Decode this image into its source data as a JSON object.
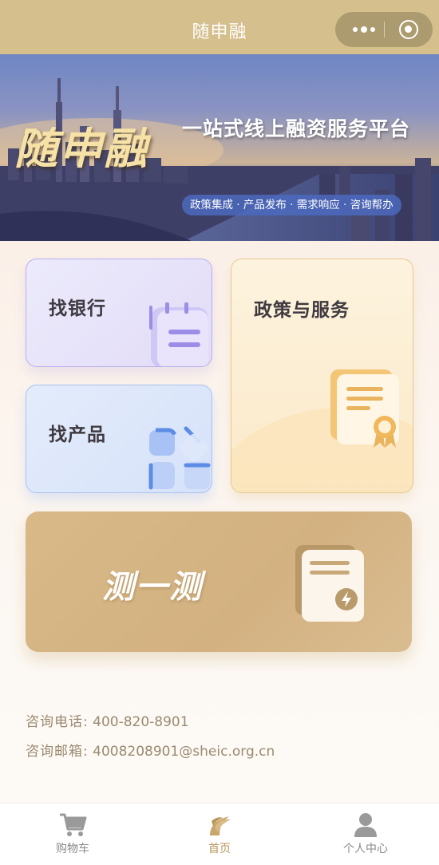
{
  "header": {
    "title": "随申融"
  },
  "banner": {
    "brand": "随申融",
    "slogan": "一站式线上融资服务平台",
    "tags": "政策集成 · 产品发布 · 需求响应 · 咨询帮办"
  },
  "cards": {
    "bank": "找银行",
    "product": "找产品",
    "policy": "政策与服务",
    "test": "测一测"
  },
  "contact": {
    "phone_label": "咨询电话:",
    "phone": "400-820-8901",
    "email_label": "咨询邮箱:",
    "email": "4008208901@sheic.org.cn"
  },
  "tabbar": {
    "items": [
      {
        "label": "购物车",
        "icon": "cart-icon"
      },
      {
        "label": "首页",
        "icon": "home-logo-icon"
      },
      {
        "label": "个人中心",
        "icon": "user-icon"
      }
    ],
    "active_index": 1,
    "active_color": "#b9975b"
  },
  "colors": {
    "header_bg": "#d4bf8d",
    "accent": "#d3b181"
  }
}
